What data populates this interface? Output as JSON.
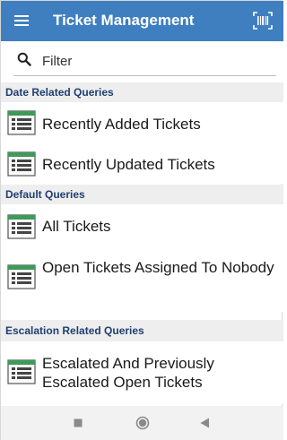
{
  "app_bar": {
    "title": "Ticket Management",
    "menu_icon": "menu-icon",
    "scan_icon": "barcode-scan-icon",
    "color": "#3f7fc0"
  },
  "filter": {
    "placeholder": "Filter",
    "value": "",
    "icon": "search-icon"
  },
  "sections": [
    {
      "header": "Date Related Queries",
      "items": [
        {
          "label": "Recently Added Tickets",
          "icon": "table-list-icon"
        },
        {
          "label": "Recently Updated Tickets",
          "icon": "table-list-icon"
        }
      ]
    },
    {
      "header": "Default Queries",
      "items": [
        {
          "label": "All Tickets",
          "icon": "table-list-icon"
        },
        {
          "label": "Open Tickets Assigned To Nobody",
          "icon": "table-list-icon"
        }
      ]
    },
    {
      "header": "Escalation Related Queries",
      "items": [
        {
          "label": "Escalated And Previously Escalated Open Tickets",
          "icon": "table-list-icon"
        }
      ]
    }
  ],
  "nav_bar": {
    "recents_icon": "square-recents-icon",
    "home_icon": "circle-home-icon",
    "back_icon": "triangle-back-icon"
  }
}
